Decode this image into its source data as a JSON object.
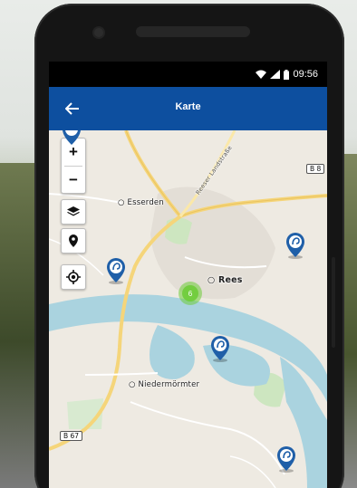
{
  "status_bar": {
    "time": "09:56"
  },
  "app_bar": {
    "title": "Karte",
    "back_icon": "arrow-left-icon"
  },
  "map": {
    "cluster_count": "6",
    "places": {
      "esserden": "Esserden",
      "rees": "Rees",
      "niedermoermter": "Niedermörmter",
      "street": "Reeser Landstraße"
    },
    "road_shields": {
      "b8": "B 8",
      "b67": "B 67"
    },
    "controls": {
      "zoom_in": "+",
      "zoom_out": "−"
    }
  },
  "colors": {
    "app_bar": "#0d4f9f",
    "marker": "#1f5fa8",
    "cluster": "#6ecc39",
    "water": "#aad3df"
  }
}
